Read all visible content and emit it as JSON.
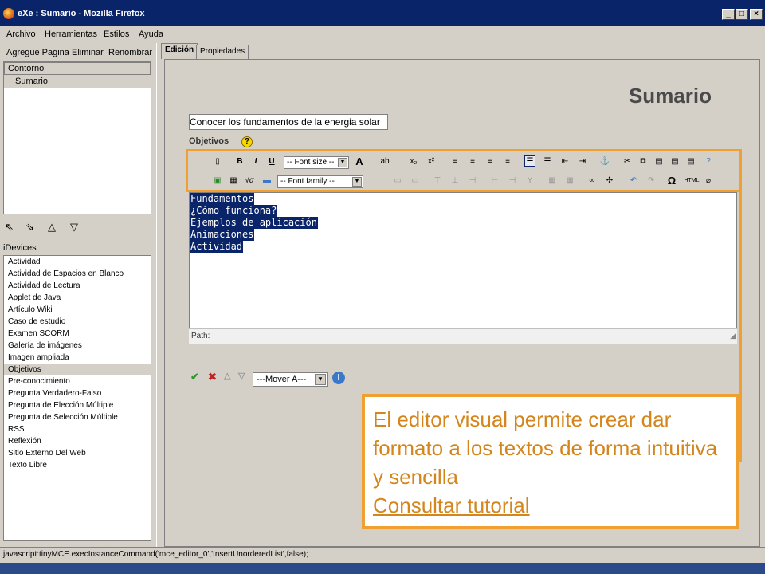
{
  "window": {
    "title": "eXe : Sumario - Mozilla Firefox",
    "min": "_",
    "max": "□",
    "close": "×"
  },
  "menu": [
    "Archivo",
    "Herramientas",
    "Estilos",
    "Ayuda"
  ],
  "left_toolbar": {
    "add": "Agregue Pagina",
    "delete": "Eliminar",
    "rename": "Renombrar"
  },
  "outline": {
    "header": "Contorno",
    "selected": "Sumario"
  },
  "nav_icons": [
    "promote-icon",
    "demote-icon",
    "up-icon",
    "down-icon"
  ],
  "idevices": {
    "label": "iDevices",
    "items": [
      "Actividad",
      "Actividad de Espacios en Blanco",
      "Actividad de Lectura",
      "Applet de Java",
      "Artículo Wiki",
      "Caso de estudio",
      "Examen SCORM",
      "Galería de imágenes",
      "Imagen ampliada",
      "Objetivos",
      "Pre-conocimiento",
      "Pregunta Verdadero-Falso",
      "Pregunta de Elección Múltiple",
      "Pregunta de Selección Múltiple",
      "RSS",
      "Reflexión",
      "Sitio Externo Del Web",
      "Texto Libre"
    ],
    "selected": "Objetivos"
  },
  "tabs": [
    "Edición",
    "Propiedades"
  ],
  "page": {
    "title": "Sumario",
    "title_input": "Conocer los fundamentos de la energia solar",
    "objetivos_label": "Objetivos",
    "help_glyph": "?"
  },
  "toolbar": {
    "font_size": "-- Font size --",
    "font_family": "-- Font family --"
  },
  "editor": {
    "lines": [
      "Fundamentos",
      "¿Cómo funciona?",
      "Ejemplos de aplicación",
      "Animaciones",
      "Actividad"
    ],
    "path_label": "Path:"
  },
  "actions": {
    "move_select": "---Mover A---",
    "info_glyph": "i"
  },
  "callout": {
    "text": "El editor visual permite crear dar formato a los textos de forma intuitiva y sencilla",
    "link": "Consultar tutorial"
  },
  "status": "javascript:tinyMCE.execInstanceCommand('mce_editor_0','InsertUnorderedList',false);",
  "colors": {
    "accent_orange": "#f0a030",
    "selection_blue": "#0a246a",
    "title_gray": "#4a4a4a"
  }
}
